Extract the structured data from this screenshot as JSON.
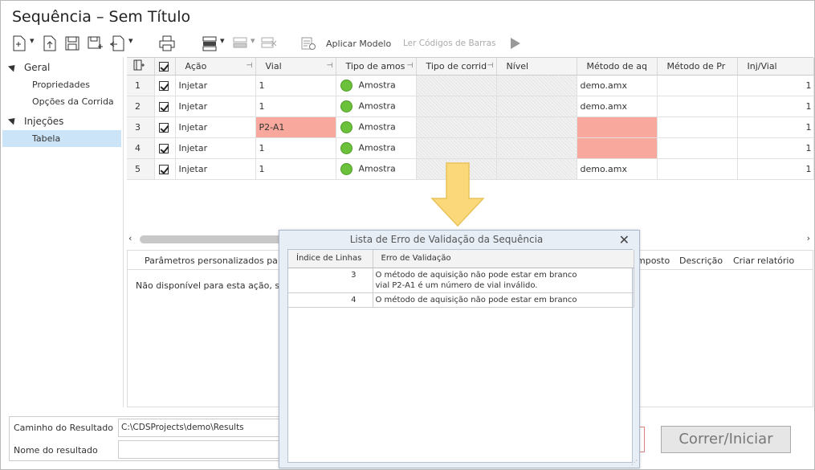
{
  "window": {
    "title": "Sequência – Sem Título"
  },
  "toolbar": {
    "apply_template": "Aplicar Modelo",
    "read_barcodes": "Ler Códigos de Barras"
  },
  "sidebar": {
    "groups": [
      {
        "label": "Geral",
        "items": [
          "Propriedades",
          "Opções da Corrida"
        ]
      },
      {
        "label": "Injeções",
        "items": [
          "Tabela"
        ]
      }
    ]
  },
  "grid": {
    "columns": [
      "Ação",
      "Vial",
      "Tipo de amos",
      "Tipo de corrid",
      "Nível",
      "Método de aq",
      "Método de Pr",
      "Inj/Vial"
    ],
    "rows": [
      {
        "num": "1",
        "action": "Injetar",
        "vial": "1",
        "sample_type": "Amostra",
        "acq_method": "demo.amx",
        "inj": "1"
      },
      {
        "num": "2",
        "action": "Injetar",
        "vial": "1",
        "sample_type": "Amostra",
        "acq_method": "demo.amx",
        "inj": "1"
      },
      {
        "num": "3",
        "action": "Injetar",
        "vial": "P2-A1",
        "sample_type": "Amostra",
        "acq_method": "",
        "inj": "1"
      },
      {
        "num": "4",
        "action": "Injetar",
        "vial": "1",
        "sample_type": "Amostra",
        "acq_method": "",
        "inj": "1"
      },
      {
        "num": "5",
        "action": "Injetar",
        "vial": "1",
        "sample_type": "Amostra",
        "acq_method": "demo.amx",
        "inj": "1"
      }
    ]
  },
  "lower_panel": {
    "tabs": [
      "Parâmetros personalizados pa",
      "mposto",
      "Descrição",
      "Criar relatório"
    ],
    "message": "Não disponível para esta ação, s"
  },
  "bottom": {
    "result_path_label": "Caminho do Resultado",
    "result_path_value": "C:\\CDSProjects\\demo\\Results",
    "result_name_label": "Nome do resultado",
    "result_name_value": "",
    "run_button": "Correr/Iniciar"
  },
  "dialog": {
    "title": "Lista de Erro de Validação da Sequência",
    "columns": [
      "Índice de Linhas",
      "Erro de Validação"
    ],
    "rows": [
      {
        "index": "3",
        "error_line1": "O método de aquisição não pode estar em branco",
        "error_line2": "vial P2-A1 é um número de vial inválido."
      },
      {
        "index": "4",
        "error_line1": "O método de aquisição não pode estar em branco",
        "error_line2": ""
      }
    ]
  },
  "colors": {
    "error_cell": "#f8a89c",
    "status_dot": "#6cc13a",
    "arrow": "#fbd97a"
  }
}
